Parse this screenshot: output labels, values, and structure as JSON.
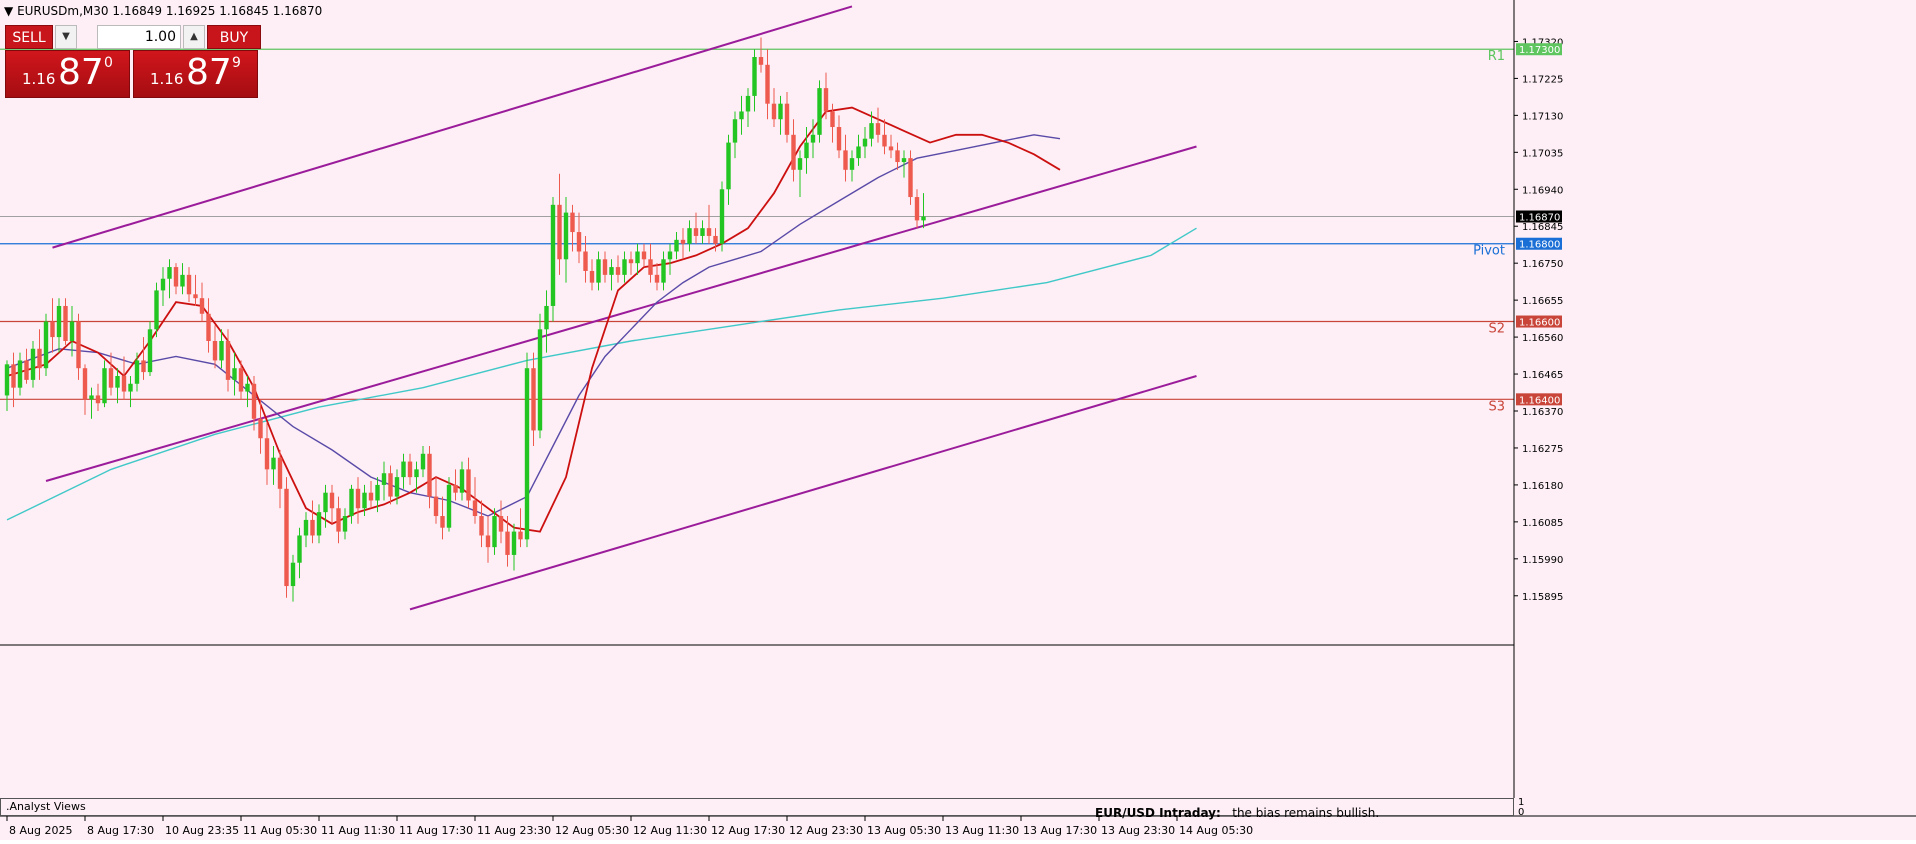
{
  "header": {
    "symbol": "EURUSDm,M30",
    "ohlc": "1.16849 1.16925 1.16845 1.16870"
  },
  "trade_panel": {
    "sell_label": "SELL",
    "buy_label": "BUY",
    "lot_value": "1.00",
    "sell_price": {
      "small": "1.16",
      "big": "87",
      "sup": "0"
    },
    "buy_price": {
      "small": "1.16",
      "big": "87",
      "sup": "9"
    }
  },
  "bottom_panel": {
    "label": ".Analyst Views",
    "title": "EUR/USD Intraday:",
    "text": "the bias remains bullish.",
    "sub_axis_top": "1",
    "sub_axis_bottom": "0"
  },
  "colors": {
    "background": "#fdeff5",
    "bull": "#22c522",
    "bear": "#ee5a4e",
    "ma_fast": "#cc1010",
    "ma_slow": "#5a4aa8",
    "ma_long": "#40c8c8",
    "channel": "#9b1c9b",
    "r1": "#5fc55f",
    "pivot": "#1a6fd6",
    "support": "#c9453a"
  },
  "chart_data": {
    "type": "candlestick",
    "symbol": "EURUSDm",
    "timeframe": "M30",
    "ylim": [
      1.1584,
      1.1737
    ],
    "y_ticks": [
      "1.17320",
      "1.17225",
      "1.17130",
      "1.17035",
      "1.16940",
      "1.16845",
      "1.16750",
      "1.16655",
      "1.16560",
      "1.16465",
      "1.16370",
      "1.16275",
      "1.16180",
      "1.16085",
      "1.15990",
      "1.15895"
    ],
    "x_ticks": [
      {
        "i": 0,
        "label": "8 Aug 2025"
      },
      {
        "i": 12,
        "label": "8 Aug 17:30"
      },
      {
        "i": 24,
        "label": "10 Aug 23:35"
      },
      {
        "i": 36,
        "label": "11 Aug 05:30"
      },
      {
        "i": 48,
        "label": "11 Aug 11:30"
      },
      {
        "i": 60,
        "label": "11 Aug 17:30"
      },
      {
        "i": 72,
        "label": "11 Aug 23:30"
      },
      {
        "i": 84,
        "label": "12 Aug 05:30"
      },
      {
        "i": 96,
        "label": "12 Aug 11:30"
      },
      {
        "i": 108,
        "label": "12 Aug 17:30"
      },
      {
        "i": 120,
        "label": "12 Aug 23:30"
      },
      {
        "i": 132,
        "label": "13 Aug 05:30"
      },
      {
        "i": 144,
        "label": "13 Aug 11:30"
      },
      {
        "i": 156,
        "label": "13 Aug 17:30"
      },
      {
        "i": 168,
        "label": "13 Aug 23:30"
      },
      {
        "i": 180,
        "label": "14 Aug 05:30"
      }
    ],
    "levels": [
      {
        "name": "R1",
        "value": 1.173,
        "label": "1.17300",
        "type": "r1"
      },
      {
        "name": "Pivot",
        "value": 1.168,
        "label": "1.16800",
        "type": "pivot"
      },
      {
        "name": "S2",
        "value": 1.166,
        "label": "1.16600",
        "type": "support"
      },
      {
        "name": "S3",
        "value": 1.164,
        "label": "1.16400",
        "type": "support"
      }
    ],
    "current_price": {
      "value": 1.1687,
      "label": "1.16870"
    },
    "channel": [
      {
        "i0": 7,
        "p0": 1.1679,
        "i1": 130,
        "p1": 1.1741
      },
      {
        "i0": 6,
        "p0": 1.1619,
        "i1": 183,
        "p1": 1.1705
      },
      {
        "i0": 62,
        "p0": 1.1586,
        "i1": 183,
        "p1": 1.1646
      }
    ],
    "candles": [
      [
        1.1641,
        1.165,
        1.1637,
        1.1649
      ],
      [
        1.1649,
        1.1652,
        1.1638,
        1.1643
      ],
      [
        1.1643,
        1.1652,
        1.1641,
        1.165
      ],
      [
        1.165,
        1.1653,
        1.1644,
        1.1645
      ],
      [
        1.1645,
        1.1655,
        1.1643,
        1.1653
      ],
      [
        1.1653,
        1.1658,
        1.1645,
        1.1648
      ],
      [
        1.1648,
        1.1662,
        1.1646,
        1.166
      ],
      [
        1.166,
        1.1666,
        1.1652,
        1.1656
      ],
      [
        1.1656,
        1.1666,
        1.1652,
        1.1664
      ],
      [
        1.1664,
        1.1666,
        1.1654,
        1.1655
      ],
      [
        1.1655,
        1.1664,
        1.1651,
        1.166
      ],
      [
        1.166,
        1.1662,
        1.1645,
        1.1648
      ],
      [
        1.1648,
        1.1649,
        1.1636,
        1.164
      ],
      [
        1.164,
        1.1643,
        1.1635,
        1.1641
      ],
      [
        1.1641,
        1.1644,
        1.1637,
        1.1639
      ],
      [
        1.1639,
        1.165,
        1.1638,
        1.1648
      ],
      [
        1.1648,
        1.1652,
        1.1641,
        1.1643
      ],
      [
        1.1643,
        1.1648,
        1.1639,
        1.1646
      ],
      [
        1.1646,
        1.1651,
        1.164,
        1.1642
      ],
      [
        1.1642,
        1.1646,
        1.1638,
        1.1644
      ],
      [
        1.1644,
        1.1652,
        1.1642,
        1.165
      ],
      [
        1.165,
        1.1656,
        1.1645,
        1.1647
      ],
      [
        1.1647,
        1.166,
        1.1646,
        1.1658
      ],
      [
        1.1658,
        1.167,
        1.1656,
        1.1668
      ],
      [
        1.1668,
        1.1674,
        1.1664,
        1.1671
      ],
      [
        1.1671,
        1.1676,
        1.1666,
        1.1674
      ],
      [
        1.1674,
        1.1675,
        1.1667,
        1.1669
      ],
      [
        1.1669,
        1.1675,
        1.1667,
        1.1672
      ],
      [
        1.1672,
        1.1674,
        1.1665,
        1.1667
      ],
      [
        1.1667,
        1.1672,
        1.1664,
        1.1666
      ],
      [
        1.1666,
        1.167,
        1.166,
        1.1662
      ],
      [
        1.1662,
        1.1666,
        1.1652,
        1.1655
      ],
      [
        1.1655,
        1.1659,
        1.1648,
        1.165
      ],
      [
        1.165,
        1.1658,
        1.1648,
        1.1655
      ],
      [
        1.1655,
        1.1658,
        1.1642,
        1.1645
      ],
      [
        1.1645,
        1.1652,
        1.1641,
        1.1648
      ],
      [
        1.1648,
        1.165,
        1.164,
        1.1642
      ],
      [
        1.1642,
        1.1646,
        1.1638,
        1.1644
      ],
      [
        1.1644,
        1.1646,
        1.1632,
        1.1635
      ],
      [
        1.1635,
        1.164,
        1.1626,
        1.163
      ],
      [
        1.163,
        1.1634,
        1.1618,
        1.1622
      ],
      [
        1.1622,
        1.1628,
        1.1618,
        1.1625
      ],
      [
        1.1625,
        1.1627,
        1.1612,
        1.1617
      ],
      [
        1.1617,
        1.162,
        1.1589,
        1.1592
      ],
      [
        1.1592,
        1.16,
        1.1588,
        1.1598
      ],
      [
        1.1598,
        1.1607,
        1.1594,
        1.1605
      ],
      [
        1.1605,
        1.1611,
        1.1602,
        1.1609
      ],
      [
        1.1609,
        1.1614,
        1.1603,
        1.1605
      ],
      [
        1.1605,
        1.1613,
        1.1603,
        1.1611
      ],
      [
        1.1611,
        1.1618,
        1.1607,
        1.1616
      ],
      [
        1.1616,
        1.1618,
        1.1608,
        1.1612
      ],
      [
        1.1612,
        1.1615,
        1.1603,
        1.1606
      ],
      [
        1.1606,
        1.1612,
        1.1604,
        1.161
      ],
      [
        1.161,
        1.1618,
        1.1608,
        1.1617
      ],
      [
        1.1617,
        1.162,
        1.1608,
        1.1612
      ],
      [
        1.1612,
        1.1618,
        1.161,
        1.1616
      ],
      [
        1.1616,
        1.1619,
        1.1612,
        1.1614
      ],
      [
        1.1614,
        1.162,
        1.1611,
        1.1618
      ],
      [
        1.1618,
        1.1624,
        1.1614,
        1.1621
      ],
      [
        1.1621,
        1.1623,
        1.1613,
        1.1615
      ],
      [
        1.1615,
        1.1622,
        1.1613,
        1.162
      ],
      [
        1.162,
        1.1626,
        1.1617,
        1.1624
      ],
      [
        1.1624,
        1.1626,
        1.1618,
        1.162
      ],
      [
        1.162,
        1.1624,
        1.1616,
        1.1622
      ],
      [
        1.1622,
        1.1628,
        1.162,
        1.1626
      ],
      [
        1.1626,
        1.1628,
        1.1612,
        1.1615
      ],
      [
        1.1615,
        1.162,
        1.1608,
        1.161
      ],
      [
        1.161,
        1.1615,
        1.1604,
        1.1607
      ],
      [
        1.1607,
        1.162,
        1.1606,
        1.1618
      ],
      [
        1.1618,
        1.1622,
        1.1614,
        1.1616
      ],
      [
        1.1616,
        1.1624,
        1.1614,
        1.1622
      ],
      [
        1.1622,
        1.1625,
        1.1612,
        1.1614
      ],
      [
        1.1614,
        1.162,
        1.1608,
        1.161
      ],
      [
        1.161,
        1.1614,
        1.1602,
        1.1605
      ],
      [
        1.1605,
        1.161,
        1.1598,
        1.1602
      ],
      [
        1.1602,
        1.1612,
        1.16,
        1.161
      ],
      [
        1.161,
        1.1614,
        1.1603,
        1.1606
      ],
      [
        1.1606,
        1.161,
        1.1597,
        1.16
      ],
      [
        1.16,
        1.1608,
        1.1596,
        1.1606
      ],
      [
        1.1606,
        1.1612,
        1.1602,
        1.1604
      ],
      [
        1.1604,
        1.1652,
        1.1602,
        1.1648
      ],
      [
        1.1648,
        1.1652,
        1.1628,
        1.1632
      ],
      [
        1.1632,
        1.1662,
        1.163,
        1.1658
      ],
      [
        1.1658,
        1.1668,
        1.1652,
        1.1664
      ],
      [
        1.1664,
        1.1692,
        1.166,
        1.169
      ],
      [
        1.169,
        1.1698,
        1.1672,
        1.1676
      ],
      [
        1.1676,
        1.1692,
        1.167,
        1.1688
      ],
      [
        1.1688,
        1.169,
        1.1678,
        1.1683
      ],
      [
        1.1683,
        1.1688,
        1.1675,
        1.1678
      ],
      [
        1.1678,
        1.1682,
        1.167,
        1.1673
      ],
      [
        1.1673,
        1.1676,
        1.1668,
        1.167
      ],
      [
        1.167,
        1.1678,
        1.1668,
        1.1676
      ],
      [
        1.1676,
        1.1678,
        1.167,
        1.1672
      ],
      [
        1.1672,
        1.1676,
        1.1668,
        1.1674
      ],
      [
        1.1674,
        1.1677,
        1.167,
        1.1672
      ],
      [
        1.1672,
        1.1678,
        1.167,
        1.1676
      ],
      [
        1.1676,
        1.1678,
        1.1672,
        1.1675
      ],
      [
        1.1675,
        1.168,
        1.1672,
        1.1678
      ],
      [
        1.1678,
        1.168,
        1.1674,
        1.1676
      ],
      [
        1.1676,
        1.168,
        1.167,
        1.1672
      ],
      [
        1.1672,
        1.1675,
        1.1668,
        1.167
      ],
      [
        1.167,
        1.1678,
        1.1668,
        1.1676
      ],
      [
        1.1676,
        1.168,
        1.1672,
        1.1678
      ],
      [
        1.1678,
        1.1683,
        1.1676,
        1.1681
      ],
      [
        1.1681,
        1.1684,
        1.1676,
        1.168
      ],
      [
        1.168,
        1.1686,
        1.1678,
        1.1684
      ],
      [
        1.1684,
        1.1688,
        1.168,
        1.1682
      ],
      [
        1.1682,
        1.1686,
        1.168,
        1.1684
      ],
      [
        1.1684,
        1.169,
        1.168,
        1.1682
      ],
      [
        1.1682,
        1.1684,
        1.1678,
        1.168
      ],
      [
        1.168,
        1.1696,
        1.1678,
        1.1694
      ],
      [
        1.1694,
        1.1708,
        1.169,
        1.1706
      ],
      [
        1.1706,
        1.1714,
        1.1702,
        1.1712
      ],
      [
        1.1712,
        1.1718,
        1.1708,
        1.1714
      ],
      [
        1.1714,
        1.172,
        1.171,
        1.1718
      ],
      [
        1.1718,
        1.173,
        1.1714,
        1.1728
      ],
      [
        1.1728,
        1.1733,
        1.1724,
        1.1726
      ],
      [
        1.1726,
        1.173,
        1.1712,
        1.1716
      ],
      [
        1.1716,
        1.172,
        1.171,
        1.1712
      ],
      [
        1.1712,
        1.1718,
        1.1708,
        1.1716
      ],
      [
        1.1716,
        1.1719,
        1.1706,
        1.1708
      ],
      [
        1.1708,
        1.1712,
        1.1696,
        1.1699
      ],
      [
        1.1699,
        1.1704,
        1.1692,
        1.1702
      ],
      [
        1.1702,
        1.171,
        1.1698,
        1.1706
      ],
      [
        1.1706,
        1.1712,
        1.1702,
        1.1708
      ],
      [
        1.1708,
        1.1722,
        1.1706,
        1.172
      ],
      [
        1.172,
        1.1724,
        1.1712,
        1.1714
      ],
      [
        1.1714,
        1.1716,
        1.1706,
        1.171
      ],
      [
        1.171,
        1.1713,
        1.1702,
        1.1704
      ],
      [
        1.1704,
        1.1708,
        1.1696,
        1.1699
      ],
      [
        1.1699,
        1.1704,
        1.1696,
        1.1702
      ],
      [
        1.1702,
        1.1708,
        1.17,
        1.1705
      ],
      [
        1.1705,
        1.171,
        1.1702,
        1.1707
      ],
      [
        1.1707,
        1.1714,
        1.1705,
        1.1711
      ],
      [
        1.1711,
        1.1715,
        1.1706,
        1.1708
      ],
      [
        1.1708,
        1.1712,
        1.1703,
        1.1705
      ],
      [
        1.1705,
        1.1708,
        1.1702,
        1.1704
      ],
      [
        1.1704,
        1.1706,
        1.1699,
        1.1701
      ],
      [
        1.1701,
        1.1704,
        1.1697,
        1.1702
      ],
      [
        1.1702,
        1.1704,
        1.169,
        1.1692
      ],
      [
        1.1692,
        1.1694,
        1.1684,
        1.1686
      ],
      [
        1.1686,
        1.1693,
        1.1684,
        1.1687
      ]
    ],
    "ma_fast": [
      [
        0,
        1.1646
      ],
      [
        6,
        1.1649
      ],
      [
        10,
        1.1655
      ],
      [
        14,
        1.1652
      ],
      [
        18,
        1.1646
      ],
      [
        22,
        1.1655
      ],
      [
        26,
        1.1665
      ],
      [
        30,
        1.1664
      ],
      [
        34,
        1.1655
      ],
      [
        38,
        1.1643
      ],
      [
        42,
        1.1626
      ],
      [
        46,
        1.1612
      ],
      [
        50,
        1.1608
      ],
      [
        54,
        1.1611
      ],
      [
        58,
        1.1613
      ],
      [
        62,
        1.1616
      ],
      [
        66,
        1.162
      ],
      [
        70,
        1.1617
      ],
      [
        74,
        1.1612
      ],
      [
        78,
        1.1607
      ],
      [
        82,
        1.1606
      ],
      [
        86,
        1.162
      ],
      [
        90,
        1.1648
      ],
      [
        94,
        1.1668
      ],
      [
        98,
        1.1674
      ],
      [
        102,
        1.1675
      ],
      [
        106,
        1.1677
      ],
      [
        110,
        1.168
      ],
      [
        114,
        1.1684
      ],
      [
        118,
        1.1693
      ],
      [
        122,
        1.1705
      ],
      [
        126,
        1.1714
      ],
      [
        130,
        1.1715
      ],
      [
        134,
        1.1712
      ],
      [
        138,
        1.1709
      ],
      [
        142,
        1.1706
      ],
      [
        146,
        1.1708
      ],
      [
        150,
        1.1708
      ],
      [
        154,
        1.1706
      ],
      [
        158,
        1.1703
      ],
      [
        162,
        1.1699
      ]
    ],
    "ma_slow": [
      [
        0,
        1.1648
      ],
      [
        8,
        1.1653
      ],
      [
        14,
        1.1652
      ],
      [
        20,
        1.1649
      ],
      [
        26,
        1.1651
      ],
      [
        32,
        1.1649
      ],
      [
        38,
        1.1641
      ],
      [
        44,
        1.1633
      ],
      [
        50,
        1.1627
      ],
      [
        56,
        1.162
      ],
      [
        62,
        1.1616
      ],
      [
        68,
        1.1614
      ],
      [
        74,
        1.161
      ],
      [
        80,
        1.1615
      ],
      [
        84,
        1.1628
      ],
      [
        88,
        1.1641
      ],
      [
        92,
        1.1651
      ],
      [
        96,
        1.1658
      ],
      [
        100,
        1.1665
      ],
      [
        104,
        1.167
      ],
      [
        108,
        1.1674
      ],
      [
        112,
        1.1676
      ],
      [
        116,
        1.1678
      ],
      [
        122,
        1.1685
      ],
      [
        128,
        1.1691
      ],
      [
        134,
        1.1697
      ],
      [
        140,
        1.1702
      ],
      [
        146,
        1.1704
      ],
      [
        152,
        1.1706
      ],
      [
        158,
        1.1708
      ],
      [
        162,
        1.1707
      ]
    ],
    "ma_long": [
      [
        0,
        1.1609
      ],
      [
        16,
        1.1622
      ],
      [
        32,
        1.1631
      ],
      [
        48,
        1.1638
      ],
      [
        64,
        1.1643
      ],
      [
        80,
        1.165
      ],
      [
        96,
        1.1655
      ],
      [
        112,
        1.1659
      ],
      [
        128,
        1.1663
      ],
      [
        144,
        1.1666
      ],
      [
        160,
        1.167
      ],
      [
        176,
        1.1677
      ],
      [
        183,
        1.1684
      ]
    ]
  }
}
